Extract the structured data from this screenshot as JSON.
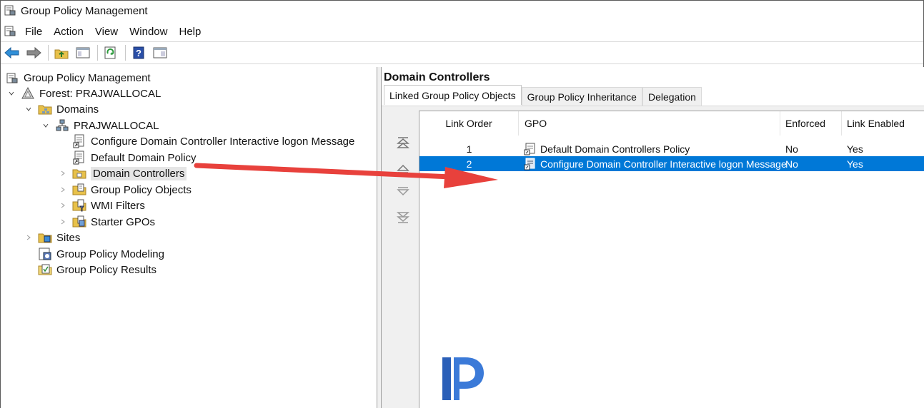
{
  "window": {
    "title": "Group Policy Management"
  },
  "menu": [
    "File",
    "Action",
    "View",
    "Window",
    "Help"
  ],
  "toolbar": {
    "icons": [
      "back-arrow-icon",
      "forward-arrow-icon",
      "up-folder-icon",
      "show-hide-tree-icon",
      "refresh-icon",
      "help-icon",
      "properties-icon"
    ]
  },
  "tree": {
    "root": "Group Policy Management",
    "forest": "Forest: PRAJWALLOCAL",
    "domains": "Domains",
    "domain": "PRAJWALLOCAL",
    "gpo1": "Configure Domain Controller Interactive logon Message",
    "gpo2": "Default Domain Policy",
    "dc": "Domain Controllers",
    "gpo_objects": "Group Policy Objects",
    "wmi": "WMI Filters",
    "starter": "Starter GPOs",
    "sites": "Sites",
    "modeling": "Group Policy Modeling",
    "results": "Group Policy Results"
  },
  "right": {
    "title": "Domain Controllers",
    "tabs": [
      "Linked Group Policy Objects",
      "Group Policy Inheritance",
      "Delegation"
    ],
    "columns": {
      "link_order": "Link Order",
      "gpo": "GPO",
      "enforced": "Enforced",
      "link_enabled": "Link Enabled"
    },
    "rows": [
      {
        "order": "1",
        "gpo": "Default Domain Controllers Policy",
        "enforced": "No",
        "enabled": "Yes",
        "selected": false
      },
      {
        "order": "2",
        "gpo": "Configure Domain Controller Interactive logon Message",
        "enforced": "No",
        "enabled": "Yes",
        "selected": true
      }
    ]
  },
  "colors": {
    "selection": "#0078d7",
    "arrow": "#e8413c",
    "logo": "#2f6fd6"
  }
}
